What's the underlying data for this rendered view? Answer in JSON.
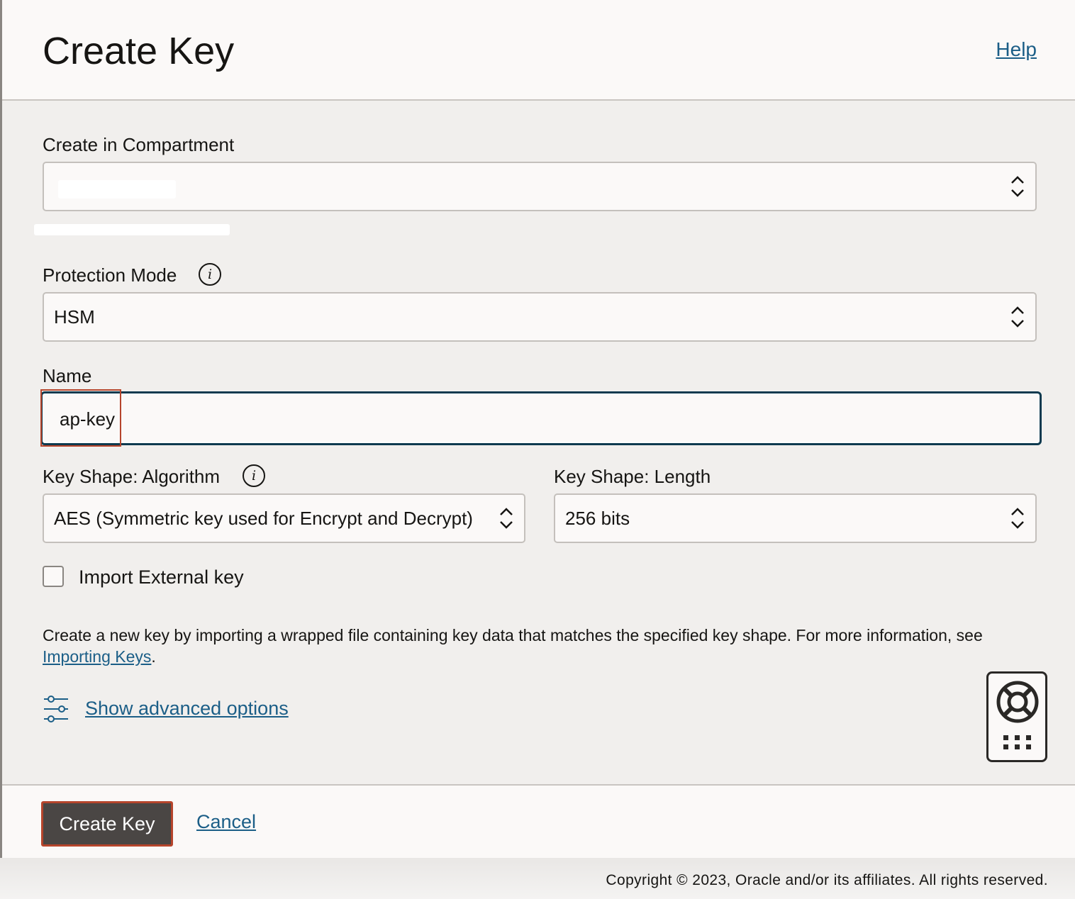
{
  "header": {
    "title": "Create Key",
    "help_label": "Help"
  },
  "compartment": {
    "label": "Create in Compartment",
    "value": "",
    "path": ""
  },
  "protection_mode": {
    "label": "Protection Mode",
    "value": "HSM",
    "info_icon": "info-icon"
  },
  "name": {
    "label": "Name",
    "value": "ap-key"
  },
  "key_algorithm": {
    "label": "Key Shape: Algorithm",
    "value": "AES (Symmetric key used for Encrypt and Decrypt)",
    "info_icon": "info-icon"
  },
  "key_length": {
    "label": "Key Shape: Length",
    "value": "256 bits"
  },
  "import_external": {
    "label": "Import External key",
    "checked": false
  },
  "description": {
    "text": "Create a new key by importing a wrapped file containing key data that matches the specified key shape. For more information, see ",
    "link": "Importing Keys",
    "suffix": "."
  },
  "advanced": {
    "label": "Show advanced options",
    "icon": "sliders-icon"
  },
  "help_widget": {
    "icon": "lifebuoy-icon",
    "grid_icon": "grid-dots-icon"
  },
  "footer": {
    "create_label": "Create Key",
    "cancel_label": "Cancel"
  },
  "copyright": "Copyright © 2023, Oracle and/or its affiliates. All rights reserved.",
  "colors": {
    "link": "#1b5e87",
    "primary_button": "#4a4644",
    "highlight": "#b6452c",
    "focus_border": "#0e3a4f"
  }
}
